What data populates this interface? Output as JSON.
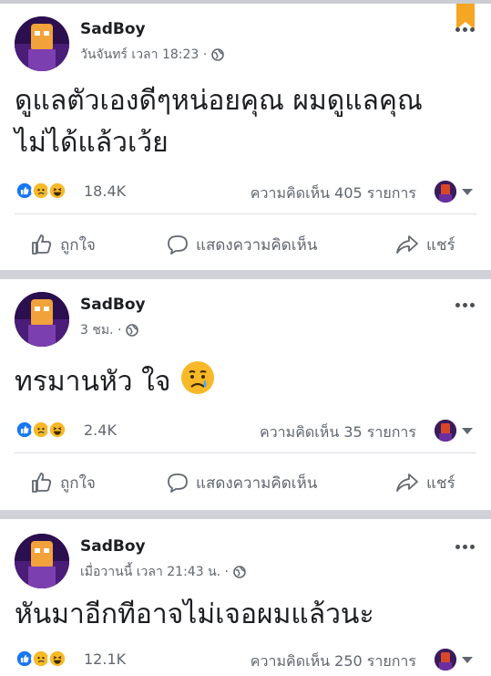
{
  "posts": [
    {
      "author": "SadBoy",
      "meta": "วันจันทร์ เวลา 18:23 ·",
      "text_line1": "ดูแลตัวเองดีๆหน่อยคุณ ผมดูแลคุณ",
      "text_line2": "ไม่ได้แล้วเว้ย",
      "reaction_count": "18.4K",
      "comments": "ความคิดเห็น 405 รายการ"
    },
    {
      "author": "SadBoy",
      "meta": "3 ชม. ·",
      "text_line1": "ทรมานหัว ใจ",
      "reaction_count": "2.4K",
      "comments": "ความคิดเห็น 35 รายการ"
    },
    {
      "author": "SadBoy",
      "meta": "เมื่อวานนี้ เวลา 21:43 น. ·",
      "text_line1": "หันมาอีกทีอาจไม่เจอผมแล้วนะ",
      "reaction_count": "12.1K",
      "comments": "ความคิดเห็น 250 รายการ"
    }
  ],
  "actions": {
    "like": "ถูกใจ",
    "comment": "แสดงความคิดเห็น",
    "share": "แชร์"
  },
  "icons": {
    "reactions": [
      "like-icon",
      "sad-icon",
      "haha-icon"
    ],
    "post_emoji": "crying-face-emoji",
    "privacy": "globe-icon",
    "bookmark": "bookmark-icon"
  },
  "colors": {
    "like_blue": "#1877f2",
    "reaction_yellow": "#f7b928",
    "bookmark_orange": "#f5a623"
  }
}
